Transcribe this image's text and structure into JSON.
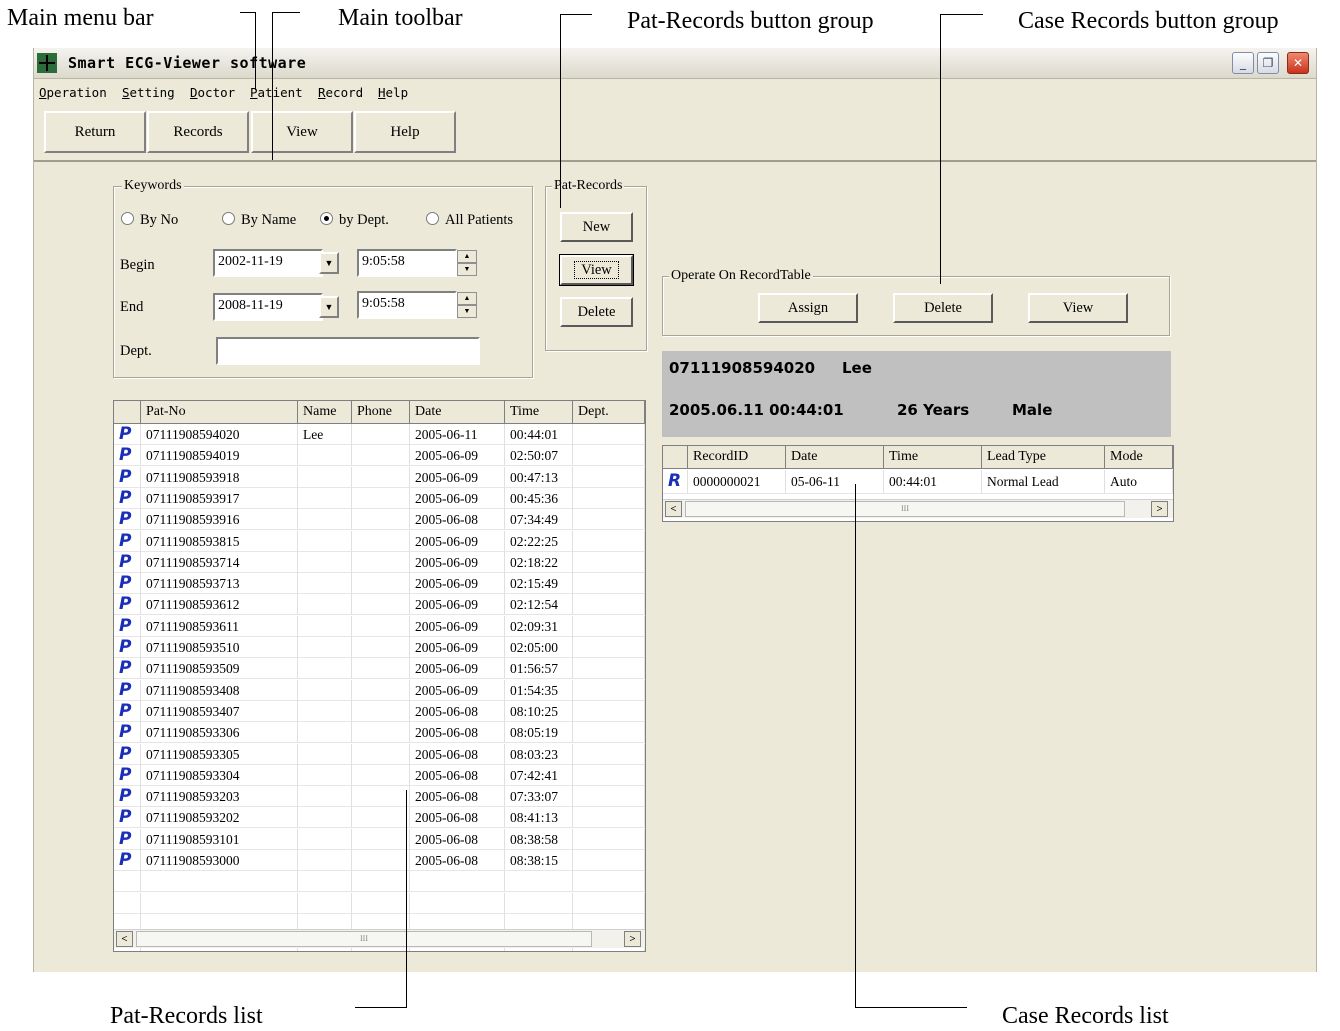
{
  "annotations": {
    "main_menu_bar": "Main menu bar",
    "main_toolbar": "Main toolbar",
    "pat_records_group": "Pat-Records button group",
    "case_records_group": "Case Records button group",
    "pat_records_list": "Pat-Records list",
    "case_records_list": "Case Records list"
  },
  "window": {
    "title": "Smart ECG-Viewer software",
    "minimize": "_",
    "restore": "❐",
    "close": "✕"
  },
  "menu": [
    "Operation",
    "Setting",
    "Doctor",
    "Patient",
    "Record",
    "Help"
  ],
  "toolbar": [
    "Return",
    "Records",
    "View",
    "Help"
  ],
  "keywords": {
    "legend": "Keywords",
    "options": [
      "By No",
      "By Name",
      "by Dept.",
      "All Patients"
    ],
    "selected": "by Dept.",
    "begin_label": "Begin",
    "begin_date": "2002-11-19",
    "begin_time": "9:05:58",
    "end_label": "End",
    "end_date": "2008-11-19",
    "end_time": "9:05:58",
    "dept_label": "Dept.",
    "dept_value": ""
  },
  "pat_group": {
    "legend": "Pat-Records",
    "buttons": [
      "New",
      "View",
      "Delete"
    ]
  },
  "case_group": {
    "legend": "Operate On RecordTable",
    "buttons": [
      "Assign",
      "Delete",
      "View"
    ]
  },
  "patient_info": {
    "id": "07111908594020",
    "name": "Lee",
    "datetime": "2005.06.11 00:44:01",
    "age": "26 Years",
    "sex": "Male"
  },
  "pat_list": {
    "columns": [
      "Pat-No",
      "Name",
      "Phone",
      "Date",
      "Time",
      "Dept."
    ],
    "row_icon": "P",
    "rows": [
      [
        "07111908594020",
        "Lee",
        "",
        "2005-06-11",
        "00:44:01",
        ""
      ],
      [
        "07111908594019",
        "",
        "",
        "2005-06-09",
        "02:50:07",
        ""
      ],
      [
        "07111908593918",
        "",
        "",
        "2005-06-09",
        "00:47:13",
        ""
      ],
      [
        "07111908593917",
        "",
        "",
        "2005-06-09",
        "00:45:36",
        ""
      ],
      [
        "07111908593916",
        "",
        "",
        "2005-06-08",
        "07:34:49",
        ""
      ],
      [
        "07111908593815",
        "",
        "",
        "2005-06-09",
        "02:22:25",
        ""
      ],
      [
        "07111908593714",
        "",
        "",
        "2005-06-09",
        "02:18:22",
        ""
      ],
      [
        "07111908593713",
        "",
        "",
        "2005-06-09",
        "02:15:49",
        ""
      ],
      [
        "07111908593612",
        "",
        "",
        "2005-06-09",
        "02:12:54",
        ""
      ],
      [
        "07111908593611",
        "",
        "",
        "2005-06-09",
        "02:09:31",
        ""
      ],
      [
        "07111908593510",
        "",
        "",
        "2005-06-09",
        "02:05:00",
        ""
      ],
      [
        "07111908593509",
        "",
        "",
        "2005-06-09",
        "01:56:57",
        ""
      ],
      [
        "07111908593408",
        "",
        "",
        "2005-06-09",
        "01:54:35",
        ""
      ],
      [
        "07111908593407",
        "",
        "",
        "2005-06-08",
        "08:10:25",
        ""
      ],
      [
        "07111908593306",
        "",
        "",
        "2005-06-08",
        "08:05:19",
        ""
      ],
      [
        "07111908593305",
        "",
        "",
        "2005-06-08",
        "08:03:23",
        ""
      ],
      [
        "07111908593304",
        "",
        "",
        "2005-06-08",
        "07:42:41",
        ""
      ],
      [
        "07111908593203",
        "",
        "",
        "2005-06-08",
        "07:33:07",
        ""
      ],
      [
        "07111908593202",
        "",
        "",
        "2005-06-08",
        "08:41:13",
        ""
      ],
      [
        "07111908593101",
        "",
        "",
        "2005-06-08",
        "08:38:58",
        ""
      ],
      [
        "07111908593000",
        "",
        "",
        "2005-06-08",
        "08:38:15",
        ""
      ]
    ]
  },
  "case_list": {
    "columns": [
      "RecordID",
      "Date",
      "Time",
      "Lead Type",
      "Mode"
    ],
    "row_icon": "R",
    "rows": [
      [
        "0000000021",
        "05-06-11",
        "00:44:01",
        "Normal Lead",
        "Auto"
      ]
    ]
  },
  "scroll": {
    "left": "<",
    "right": ">",
    "thumb": "III"
  }
}
